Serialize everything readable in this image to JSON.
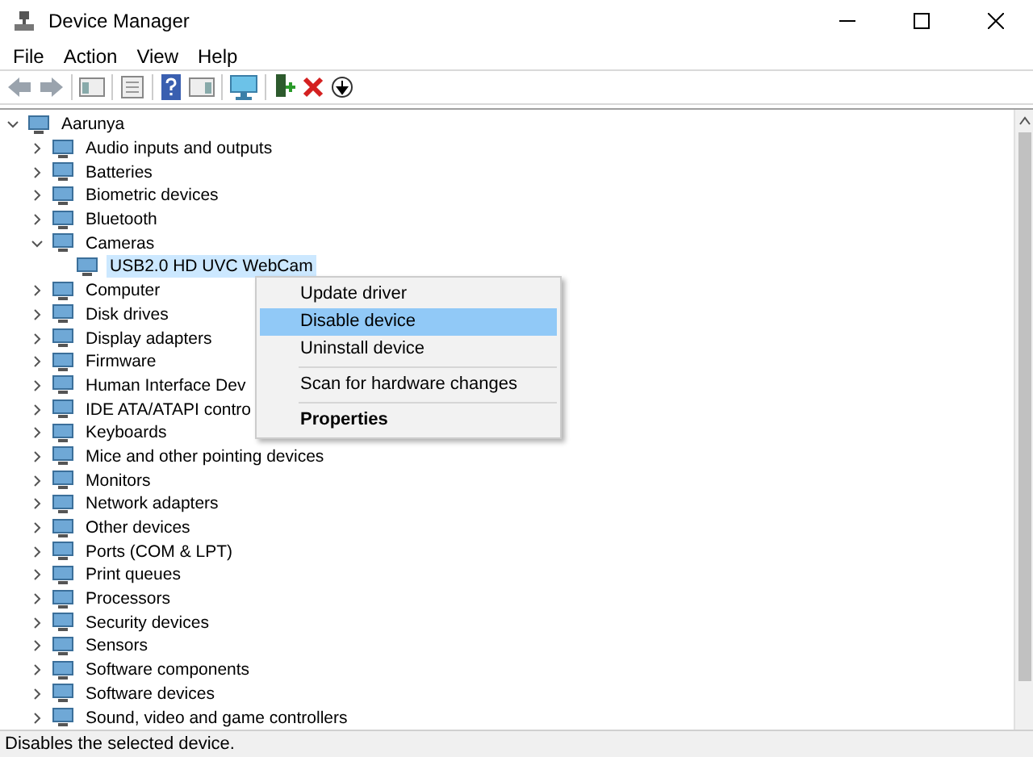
{
  "window": {
    "title": "Device Manager"
  },
  "menu_bar": [
    "File",
    "Action",
    "View",
    "Help"
  ],
  "tree": {
    "label": "Aarunya",
    "expanded": true,
    "children": [
      {
        "label": "Audio inputs and outputs",
        "expanded": false
      },
      {
        "label": "Batteries",
        "expanded": false
      },
      {
        "label": "Biometric devices",
        "expanded": false
      },
      {
        "label": "Bluetooth",
        "expanded": false
      },
      {
        "label": "Cameras",
        "expanded": true,
        "children": [
          {
            "label": "USB2.0 HD UVC WebCam",
            "selected": true
          }
        ]
      },
      {
        "label": "Computer",
        "expanded": false
      },
      {
        "label": "Disk drives",
        "expanded": false
      },
      {
        "label": "Display adapters",
        "expanded": false
      },
      {
        "label": "Firmware",
        "expanded": false
      },
      {
        "label": "Human Interface Dev",
        "expanded": false
      },
      {
        "label": "IDE ATA/ATAPI contro",
        "expanded": false
      },
      {
        "label": "Keyboards",
        "expanded": false
      },
      {
        "label": "Mice and other pointing devices",
        "expanded": false
      },
      {
        "label": "Monitors",
        "expanded": false
      },
      {
        "label": "Network adapters",
        "expanded": false
      },
      {
        "label": "Other devices",
        "expanded": false
      },
      {
        "label": "Ports (COM & LPT)",
        "expanded": false
      },
      {
        "label": "Print queues",
        "expanded": false
      },
      {
        "label": "Processors",
        "expanded": false
      },
      {
        "label": "Security devices",
        "expanded": false
      },
      {
        "label": "Sensors",
        "expanded": false
      },
      {
        "label": "Software components",
        "expanded": false
      },
      {
        "label": "Software devices",
        "expanded": false
      },
      {
        "label": "Sound, video and game controllers",
        "expanded": false
      }
    ]
  },
  "context_menu": [
    {
      "kind": "item",
      "label": "Update driver",
      "selected": false
    },
    {
      "kind": "item",
      "label": "Disable device",
      "selected": true
    },
    {
      "kind": "item",
      "label": "Uninstall device",
      "selected": false
    },
    {
      "kind": "separator"
    },
    {
      "kind": "item",
      "label": "Scan for hardware changes",
      "selected": false
    },
    {
      "kind": "separator"
    },
    {
      "kind": "default",
      "label": "Properties",
      "selected": false
    }
  ],
  "status_bar": "Disables the selected device."
}
